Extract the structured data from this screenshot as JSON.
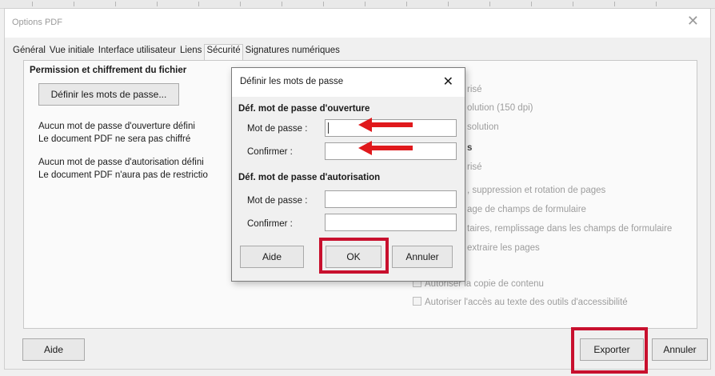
{
  "window": {
    "title": "Options PDF",
    "close_glyph": "✕"
  },
  "tabs": [
    {
      "label": "Général",
      "active": false
    },
    {
      "label": "Vue initiale",
      "active": false
    },
    {
      "label": "Interface utilisateur",
      "active": false
    },
    {
      "label": "Liens",
      "active": false
    },
    {
      "label": "Sécurité",
      "active": true
    },
    {
      "label": "Signatures numériques",
      "active": false
    }
  ],
  "security": {
    "heading": "Permission et chiffrement du fichier",
    "set_passwords_button": "Définir les mots de passe...",
    "open_pw_status": "Aucun mot de passe d'ouverture défini",
    "open_pw_note": "Le document PDF ne sera pas chiffré",
    "perm_pw_status": "Aucun mot de passe d'autorisation défini",
    "perm_pw_note": "Le document PDF n'aura pas de restrictio"
  },
  "right_panel": {
    "lines": [
      "risé",
      "olution (150 dpi)",
      "solution",
      "s",
      "risé",
      ", suppression et rotation de pages",
      "age de champs de formulaire",
      "taires, remplissage dans les champs de formulaire",
      "extraire les pages"
    ],
    "checkboxes": [
      "Autoriser la copie de contenu",
      "Autoriser l'accès au texte des outils d'accessibilité"
    ]
  },
  "password_dialog": {
    "title": "Définir les mots de passe",
    "close_glyph": "✕",
    "open_section": "Déf. mot de passe d'ouverture",
    "perm_section": "Déf. mot de passe d'autorisation",
    "password_label": "Mot de passe :",
    "confirm_label": "Confirmer :",
    "perm_password_label": "Mot de passe :",
    "perm_confirm_label": "Confirmer :",
    "help_button": "Aide",
    "ok_button": "OK",
    "cancel_button": "Annuler"
  },
  "footer": {
    "help_button": "Aide",
    "export_button": "Exporter",
    "cancel_button": "Annuler"
  },
  "colors": {
    "highlight": "#c8102e",
    "arrow": "#e0191c"
  }
}
